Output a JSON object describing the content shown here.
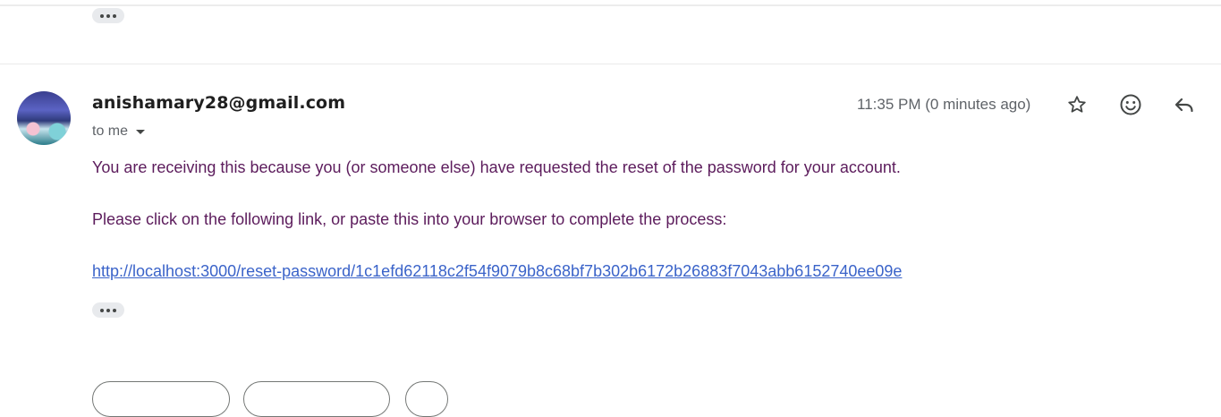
{
  "previous_message": {
    "expand_label": "Show trimmed content"
  },
  "message": {
    "sender": "anishamary28@gmail.com",
    "recipient_label": "to me",
    "timestamp": "11:35 PM (0 minutes ago)",
    "paragraphs": [
      "You are receiving this because you (or someone else) have requested the reset of the password for your account.",
      "Please click on the following link, or paste this into your browser to complete the process:"
    ],
    "reset_link": "http://localhost:3000/reset-password/1c1efd62118c2f54f9079b8c68bf7b302b6172b26883f7043abb6152740ee09e"
  },
  "actions": {
    "icons": [
      "star-icon",
      "emoji-icon",
      "reply-icon"
    ]
  },
  "colors": {
    "body_text": "#5c1c5c",
    "link": "#3a63c9",
    "muted": "#5f6368"
  }
}
